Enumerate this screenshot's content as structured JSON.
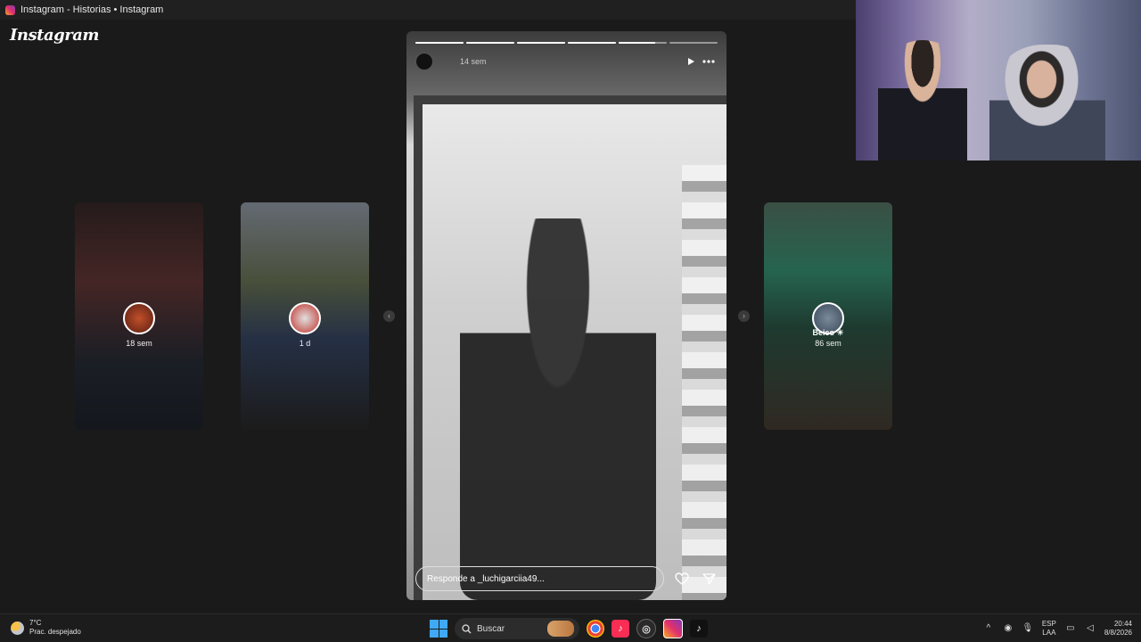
{
  "window": {
    "title": "Instagram - Historias • Instagram"
  },
  "brand": {
    "logo_text": "Instagram"
  },
  "side_stories": [
    {
      "name": "",
      "time": "18 sem"
    },
    {
      "name": "",
      "time": "1 d"
    },
    {
      "name": "Beico ☀",
      "time": "86 sem"
    }
  ],
  "main_story": {
    "time": "14 sem",
    "progress": {
      "segments": 6,
      "completed": 4,
      "current_fill": 0.75
    },
    "reply_placeholder": "Responde a _luchigarciia49..."
  },
  "taskbar": {
    "weather": {
      "temp": "7°C",
      "desc": "Prac. despejado"
    },
    "search_label": "Buscar",
    "language": {
      "top": "ESP",
      "bottom": "LAA"
    },
    "clock": {
      "time": "20:44",
      "date": "8/8/2026"
    }
  },
  "icons": {
    "play": "play-icon",
    "more": "more-icon",
    "heart": "heart-icon",
    "send": "send-icon",
    "search": "search-icon"
  },
  "colors": {
    "accent_blue": "#3fa9f5",
    "instagram_gradient": "#e1306c"
  }
}
